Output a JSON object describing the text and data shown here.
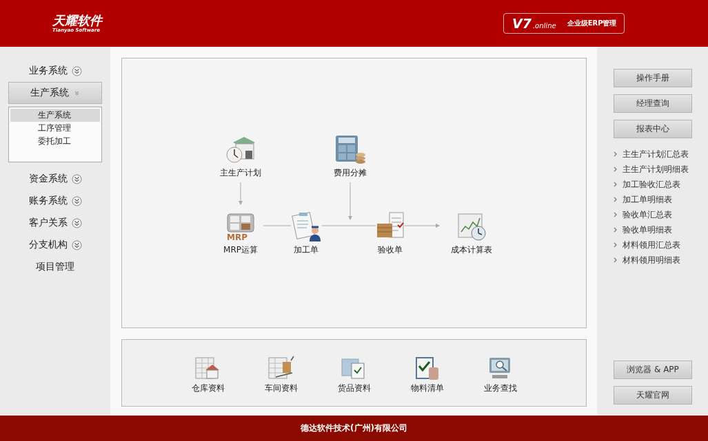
{
  "header": {
    "logo": "天耀软件",
    "logo_subtitle": "Tianyao Software",
    "version": "V7",
    "version_suffix": ".online",
    "tagline": "企业级ERP管理"
  },
  "sidebar": {
    "items": [
      {
        "label": "业务系统",
        "kind": "group",
        "expanded": false
      },
      {
        "label": "生产系统",
        "kind": "group",
        "expanded": true,
        "children": [
          {
            "label": "生产系统",
            "selected": true
          },
          {
            "label": "工序管理",
            "selected": false
          },
          {
            "label": "委托加工",
            "selected": false
          }
        ]
      },
      {
        "label": "资金系统",
        "kind": "group",
        "expanded": false
      },
      {
        "label": "账务系统",
        "kind": "group",
        "expanded": false
      },
      {
        "label": "客户关系",
        "kind": "group",
        "expanded": false
      },
      {
        "label": "分支机构",
        "kind": "group",
        "expanded": false
      },
      {
        "label": "项目管理",
        "kind": "link"
      }
    ]
  },
  "flow": {
    "nodes": [
      {
        "label": "主生产计划"
      },
      {
        "label": "费用分摊"
      },
      {
        "label": "MRP运算",
        "icon_text": "MRP"
      },
      {
        "label": "加工单"
      },
      {
        "label": "验收单"
      },
      {
        "label": "成本计算表"
      }
    ]
  },
  "shortcuts": [
    {
      "label": "仓库资料"
    },
    {
      "label": "车间资料"
    },
    {
      "label": "货品资料"
    },
    {
      "label": "物料清单"
    },
    {
      "label": "业务查找"
    }
  ],
  "right_panel": {
    "buttons": [
      "操作手册",
      "经理查询",
      "报表中心"
    ],
    "reports": [
      "主生产计划汇总表",
      "主生产计划明细表",
      "加工验收汇总表",
      "加工单明细表",
      "验收单汇总表",
      "验收单明细表",
      "材料领用汇总表",
      "材料领用明细表"
    ],
    "bottom_buttons": [
      "浏览器 & APP",
      "天耀官网"
    ]
  },
  "footer": "德达软件技术(广州)有限公司"
}
